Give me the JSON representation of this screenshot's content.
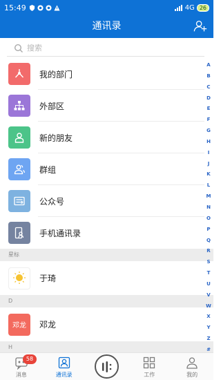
{
  "status_bar": {
    "time": "15:49",
    "network": "4G",
    "battery": "26"
  },
  "header": {
    "title": "通讯录",
    "add_user_icon": "add-user-icon"
  },
  "search": {
    "placeholder": "搜索",
    "icon": "search-icon"
  },
  "items": [
    {
      "label": "我的部门",
      "icon": "department-icon",
      "color": "#f26b6b"
    },
    {
      "label": "外部区",
      "icon": "org-chart-icon",
      "color": "#9b76d8"
    },
    {
      "label": "新的朋友",
      "icon": "new-friend-icon",
      "color": "#4cc489"
    },
    {
      "label": "群组",
      "icon": "group-icon",
      "color": "#6ea5f2"
    },
    {
      "label": "公众号",
      "icon": "official-account-icon",
      "color": "#7eb2e0"
    },
    {
      "label": "手机通讯录",
      "icon": "phone-contacts-icon",
      "color": "#7583a0"
    }
  ],
  "sections": [
    {
      "header": "星标",
      "contacts": [
        {
          "name": "于琦"
        }
      ]
    },
    {
      "header": "D",
      "contacts": [
        {
          "name": "邓龙",
          "avatar_text": "邓龙"
        }
      ]
    },
    {
      "header": "H"
    }
  ],
  "alphabet": [
    "A",
    "B",
    "C",
    "D",
    "E",
    "F",
    "G",
    "H",
    "I",
    "J",
    "K",
    "L",
    "M",
    "N",
    "O",
    "P",
    "Q",
    "R",
    "S",
    "T",
    "U",
    "V",
    "W",
    "X",
    "Y",
    "Z",
    "#"
  ],
  "tabbar": {
    "messages": {
      "label": "消息",
      "badge": "58"
    },
    "contacts": {
      "label": "通讯录"
    },
    "work": {
      "label": "工作"
    },
    "me": {
      "label": "我的"
    }
  },
  "colors": {
    "primary": "#0e72d6",
    "badge": "#e8443a",
    "section_bg": "#ececec"
  }
}
